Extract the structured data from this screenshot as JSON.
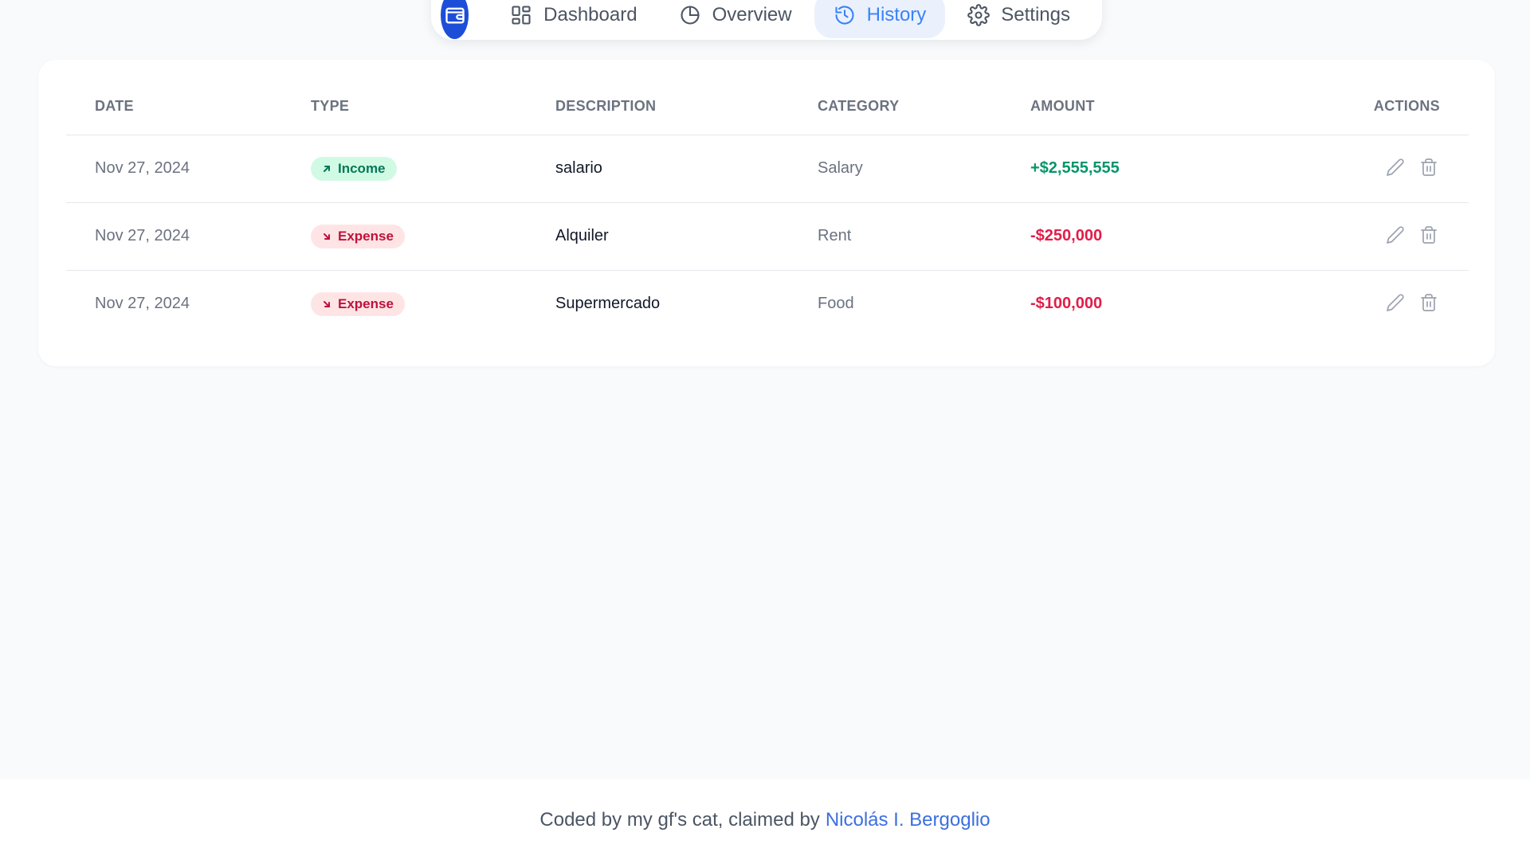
{
  "nav": {
    "logo_icon": "wallet-icon",
    "items": [
      {
        "label": "Dashboard",
        "icon": "grid-icon",
        "active": false
      },
      {
        "label": "Overview",
        "icon": "pie-chart-icon",
        "active": false
      },
      {
        "label": "History",
        "icon": "history-icon",
        "active": true
      },
      {
        "label": "Settings",
        "icon": "gear-icon",
        "active": false
      }
    ],
    "accent": "#1d4ed8",
    "active_color": "#3b82f6"
  },
  "table": {
    "headers": {
      "date": "DATE",
      "type": "TYPE",
      "description": "DESCRIPTION",
      "category": "CATEGORY",
      "amount": "AMOUNT",
      "actions": "ACTIONS"
    },
    "rows": [
      {
        "date": "Nov 27, 2024",
        "type": "Income",
        "description": "salario",
        "category": "Salary",
        "amount": "+$2,555,555"
      },
      {
        "date": "Nov 27, 2024",
        "type": "Expense",
        "description": "Alquiler",
        "category": "Rent",
        "amount": "-$250,000"
      },
      {
        "date": "Nov 27, 2024",
        "type": "Expense",
        "description": "Supermercado",
        "category": "Food",
        "amount": "-$100,000"
      }
    ],
    "income_color": "#059669",
    "expense_color": "#e11d48"
  },
  "footer": {
    "text": "Coded by my gf's cat, claimed by",
    "link_text": "Nicolás I. Bergoglio"
  }
}
